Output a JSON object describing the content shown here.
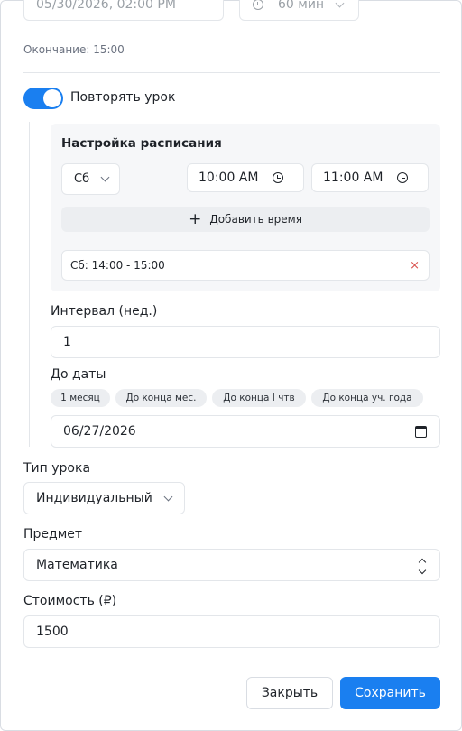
{
  "start": {
    "datetime_value": "05/30/2026, 02:00 PM",
    "duration_value": "60 мин"
  },
  "end_text": "Окончание: 15:00",
  "repeat": {
    "label": "Повторять урок",
    "enabled": true
  },
  "schedule": {
    "title": "Настройка расписания",
    "day_value": "Сб",
    "time_from": "10:00 AM",
    "time_to": "11:00 AM",
    "add_time_label": "Добавить время",
    "slots": [
      {
        "text": "Сб: 14:00 - 15:00",
        "remove": "×"
      }
    ]
  },
  "interval": {
    "label": "Интервал (нед.)",
    "value": "1"
  },
  "until": {
    "label": "До даты",
    "presets": [
      "1 месяц",
      "До конца мес.",
      "До конца I чтв",
      "До конца уч. года"
    ],
    "value": "06/27/2026"
  },
  "lesson_type": {
    "label": "Тип урока",
    "value": "Индивидуальный"
  },
  "subject": {
    "label": "Предмет",
    "value": "Математика"
  },
  "price": {
    "label": "Стоимость (₽)",
    "value": "1500"
  },
  "footer": {
    "close_label": "Закрыть",
    "save_label": "Сохранить"
  },
  "colors": {
    "accent": "#1a7ff0",
    "panel_bg": "#f6f7f9",
    "remove": "#d9534f"
  }
}
